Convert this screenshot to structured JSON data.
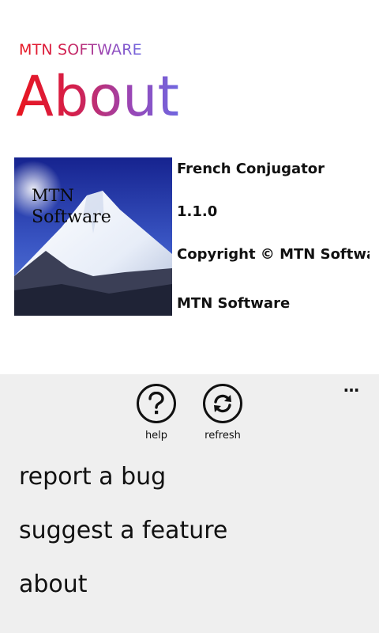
{
  "header": {
    "app_title": "MTN SOFTWARE",
    "page_title": "About"
  },
  "logo": {
    "line1": "MTN",
    "line2": "Software"
  },
  "info": {
    "app_name": "French Conjugator",
    "version": "1.1.0",
    "copyright": "Copyright © MTN Software",
    "company": "MTN Software"
  },
  "app_bar": {
    "more_icon": "…",
    "buttons": [
      {
        "label": "help",
        "icon": "question-mark"
      },
      {
        "label": "refresh",
        "icon": "sync-arrows"
      }
    ],
    "menu": [
      {
        "label": "report a bug"
      },
      {
        "label": "suggest a feature"
      },
      {
        "label": "about"
      }
    ]
  },
  "colors": {
    "title_start": "#e8161f",
    "title_end": "#6f67e0",
    "app_bar_background": "#efefef"
  }
}
